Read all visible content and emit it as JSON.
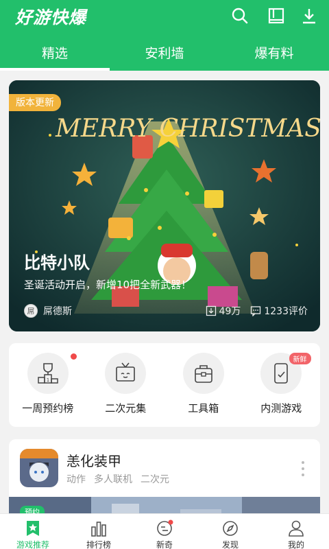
{
  "app": {
    "logo": "好游快爆"
  },
  "header": {
    "icons": [
      "search-icon",
      "book-icon",
      "download-icon"
    ],
    "tabs": [
      {
        "label": "精选",
        "active": true
      },
      {
        "label": "安利墙",
        "active": false
      },
      {
        "label": "爆有料",
        "active": false
      }
    ]
  },
  "banner": {
    "tag": "版本更新",
    "art_text": "MERRY CHRISTMAS",
    "title": "比特小队",
    "description": "圣诞活动开启，新增10把全新武器！",
    "author_avatar_text": "屌",
    "author": "屌德斯",
    "downloads": "49万",
    "comments": "1233评价"
  },
  "quick_entries": [
    {
      "label": "一周预约榜",
      "icon": "trophy-podium-icon",
      "badge_dot": true
    },
    {
      "label": "二次元集",
      "icon": "tv-icon",
      "badge_dot": false
    },
    {
      "label": "工具箱",
      "icon": "toolbox-icon",
      "badge_dot": false
    },
    {
      "label": "内测游戏",
      "icon": "phone-test-icon",
      "badge_text": "新鲜"
    }
  ],
  "game": {
    "name": "恙化装甲",
    "tags": [
      "动作",
      "多人联机",
      "二次元"
    ],
    "preorder_label": "预约"
  },
  "bottom_nav": [
    {
      "label": "游戏推荐",
      "icon": "star-tag-icon",
      "active": true
    },
    {
      "label": "排行榜",
      "icon": "bar-chart-icon",
      "active": false
    },
    {
      "label": "新奇",
      "icon": "chat-bubble-icon",
      "active": false,
      "dot": true
    },
    {
      "label": "发现",
      "icon": "compass-icon",
      "active": false
    },
    {
      "label": "我的",
      "icon": "user-icon",
      "active": false
    }
  ],
  "colors": {
    "brand": "#22bf6b",
    "badge_orange": "#f1b33b",
    "red_dot": "#f04a4a"
  }
}
